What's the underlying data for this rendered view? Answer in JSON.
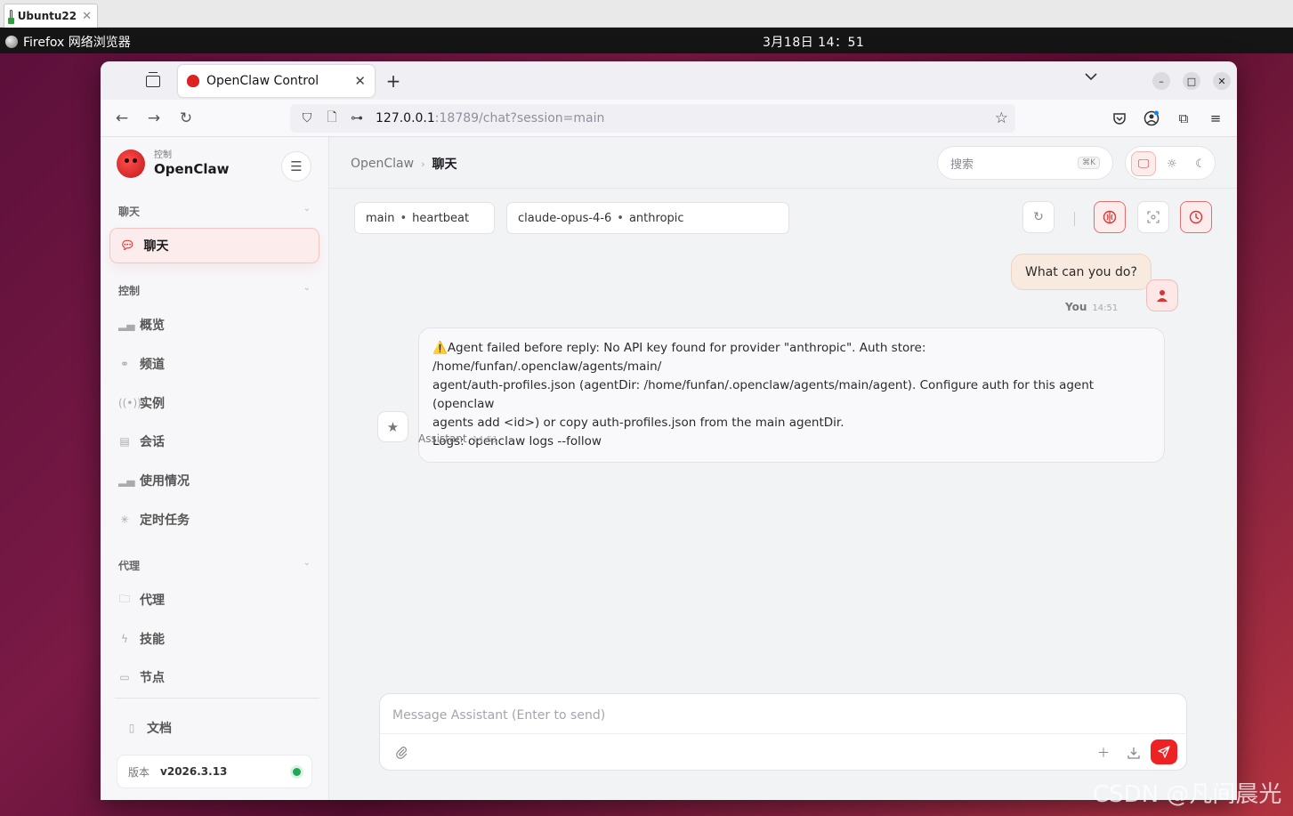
{
  "host": {
    "tab_label": "Ubuntu22",
    "tab_close": "✕"
  },
  "topbar": {
    "app_name": "Firefox 网络浏览器",
    "clock": "3月18日  14：51"
  },
  "browser": {
    "tab_title": "OpenClaw Control",
    "tab_close": "✕",
    "new_tab": "+",
    "url_host": "127.0.0.1",
    "url_rest": ":18789/chat?session=main"
  },
  "sidebar": {
    "brand_sub": "控制",
    "brand_name": "OpenClaw",
    "section_chat": "聊天",
    "active_item": "聊天",
    "section_control": "控制",
    "control_items": [
      "概览",
      "频道",
      "实例",
      "会话",
      "使用情况",
      "定时任务"
    ],
    "section_agent": "代理",
    "agent_items": [
      "代理",
      "技能",
      "节点"
    ],
    "docs": "文档",
    "version_label": "版本",
    "version_value": "v2026.3.13"
  },
  "main": {
    "breadcrumb_root": "OpenClaw",
    "breadcrumb_sep": "›",
    "breadcrumb_current": "聊天",
    "search_placeholder": "搜索",
    "search_shortcut": "⌘K",
    "session_pill": {
      "a": "main",
      "b": "heartbeat"
    },
    "model_pill": {
      "a": "claude-opus-4-6",
      "b": "anthropic"
    },
    "bullet": "•"
  },
  "chat": {
    "user_message": "What can you do?",
    "user_name": "You",
    "user_time": "14:51",
    "assistant_lines": [
      "Agent failed before reply: No API key found for provider \"anthropic\". Auth store: /home/funfan/.openclaw/agents/main/",
      "agent/auth-profiles.json (agentDir: /home/funfan/.openclaw/agents/main/agent). Configure auth for this agent (openclaw",
      "agents add <id>) or copy auth-profiles.json from the main agentDir.",
      "Logs: openclaw logs --follow"
    ],
    "warn_glyph": "⚠️",
    "assistant_name": "Assistant",
    "assistant_time": "14:51"
  },
  "composer": {
    "placeholder": "Message Assistant (Enter to send)"
  },
  "watermark": "CSDN @凡间晨光",
  "colors": {
    "accent": "#dd2222",
    "status_ok": "#1fa855",
    "user_bubble": "#f9eae0"
  }
}
